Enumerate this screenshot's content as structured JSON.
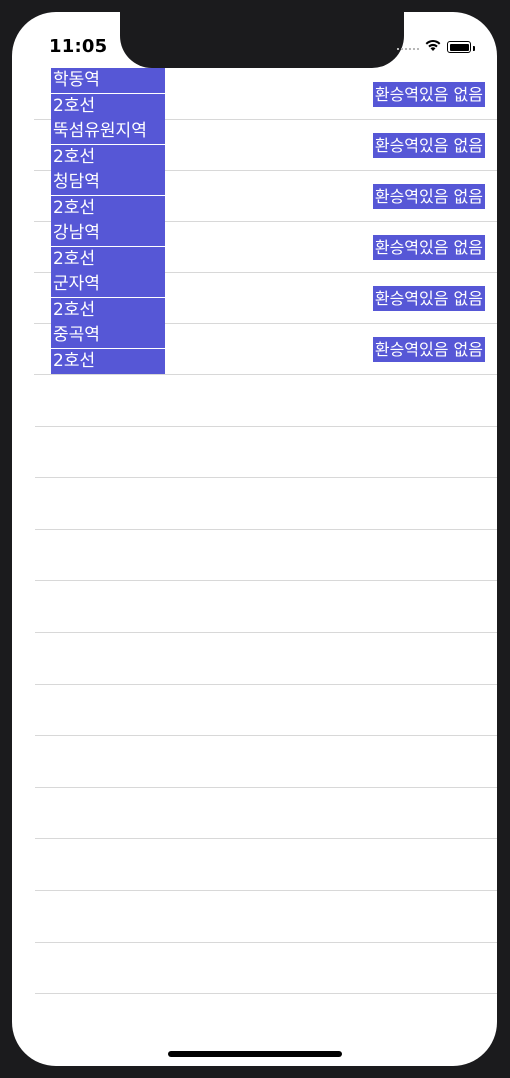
{
  "status_bar": {
    "time": "11:05",
    "icons": [
      "cellular-signal-icon",
      "wifi-icon",
      "battery-icon"
    ]
  },
  "stations": [
    {
      "name": "학동역",
      "line": "2호선",
      "transfer": "환승역있음 없음"
    },
    {
      "name": "뚝섬유원지역",
      "line": "2호선",
      "transfer": "환승역있음 없음"
    },
    {
      "name": "청담역",
      "line": "2호선",
      "transfer": "환승역있음 없음"
    },
    {
      "name": "강남역",
      "line": "2호선",
      "transfer": "환승역있음 없음"
    },
    {
      "name": "군자역",
      "line": "2호선",
      "transfer": "환승역있음 없음"
    },
    {
      "name": "중곡역",
      "line": "2호선",
      "transfer": "환승역있음 없음"
    }
  ],
  "colors": {
    "label_background": "#5657d6",
    "label_text": "#ffffff",
    "separator": "#d8d8d8",
    "device_frame": "#1b1b1d"
  }
}
